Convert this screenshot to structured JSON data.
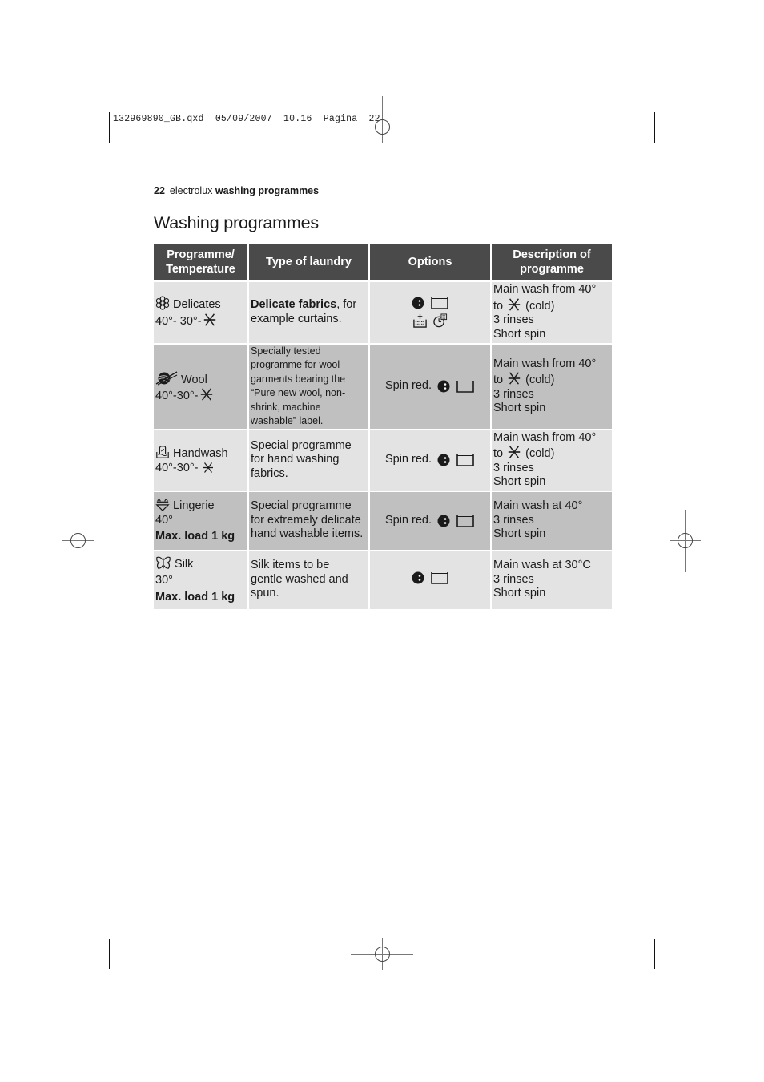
{
  "slug": {
    "text": "132969890_GB.qxd  05/09/2007  10.16  Pagina  22"
  },
  "running_head": {
    "page_number": "22",
    "brand": "electrolux",
    "section": "washing programmes"
  },
  "page_title": "Washing programmes",
  "table": {
    "headers": [
      [
        "Programme/",
        "Temperature"
      ],
      [
        "Type of laundry"
      ],
      [
        "Options"
      ],
      [
        "Description of",
        "programme"
      ]
    ],
    "rows": [
      {
        "icon": "delicates-flower-icon",
        "name": "Delicates",
        "temperature": "40°- 30°-",
        "temperature_suffix_icon": "cold-snowflake-icon",
        "max_load": "",
        "type_bold": "Delicate fabrics",
        "type_rest": ", for example curtains.",
        "options_label": "",
        "option_icons": [
          "spin-reduction-icon",
          "rinse-hold-icon",
          "prewash-icon",
          "time-saving-icon"
        ],
        "description": [
          "Main wash from 40°",
          "to",
          "(cold)",
          "3 rinses",
          "Short spin"
        ]
      },
      {
        "icon": "wool-ball-icon",
        "name": "Wool",
        "temperature": "40°-30°-",
        "temperature_suffix_icon": "cold-snowflake-icon",
        "max_load": "",
        "type_lines": [
          "Specially tested",
          "programme for wool",
          "garments bearing the",
          "“Pure new wool, non-",
          "shrink, machine",
          "washable” label."
        ],
        "options_label": "Spin red.",
        "option_icons": [
          "spin-reduction-icon",
          "rinse-hold-icon"
        ],
        "description": [
          "Main wash from 40°",
          "to",
          "(cold)",
          "3 rinses",
          "Short spin"
        ]
      },
      {
        "icon": "handwash-icon",
        "name": "Handwash",
        "temperature": "40°-30°- ",
        "temperature_suffix_icon": "cold-snowflake-icon",
        "max_load": "",
        "type_lines": [
          "Special programme",
          "for hand washing",
          "fabrics."
        ],
        "options_label": "Spin red.",
        "option_icons": [
          "spin-reduction-icon",
          "rinse-hold-icon"
        ],
        "description": [
          "Main wash from 40°",
          "to",
          "(cold)",
          "3 rinses",
          "Short spin"
        ]
      },
      {
        "icon": "lingerie-icon",
        "name": "Lingerie",
        "temperature": "40°",
        "max_load": "Max. load 1 kg",
        "type_lines": [
          "Special programme",
          "for extremely delicate",
          "hand washable items."
        ],
        "options_label": "Spin red.",
        "option_icons": [
          "spin-reduction-icon",
          "rinse-hold-icon"
        ],
        "description": [
          "Main wash at 40°",
          "3 rinses",
          "Short spin"
        ]
      },
      {
        "icon": "silk-butterfly-icon",
        "name": "Silk",
        "temperature": "30°",
        "max_load": "Max. load 1 kg",
        "type_lines": [
          "Silk items to be",
          "gentle washed and",
          "spun."
        ],
        "options_label": "",
        "option_icons": [
          "spin-reduction-icon",
          "rinse-hold-icon"
        ],
        "description": [
          "Main wash at 30°C",
          "3 rinses",
          "Short spin"
        ]
      }
    ]
  },
  "colors": {
    "header_bg": "#4a4a4a",
    "row_light": "#e3e3e3",
    "row_dark": "#c0c0c0",
    "text": "#1a1a1a"
  }
}
